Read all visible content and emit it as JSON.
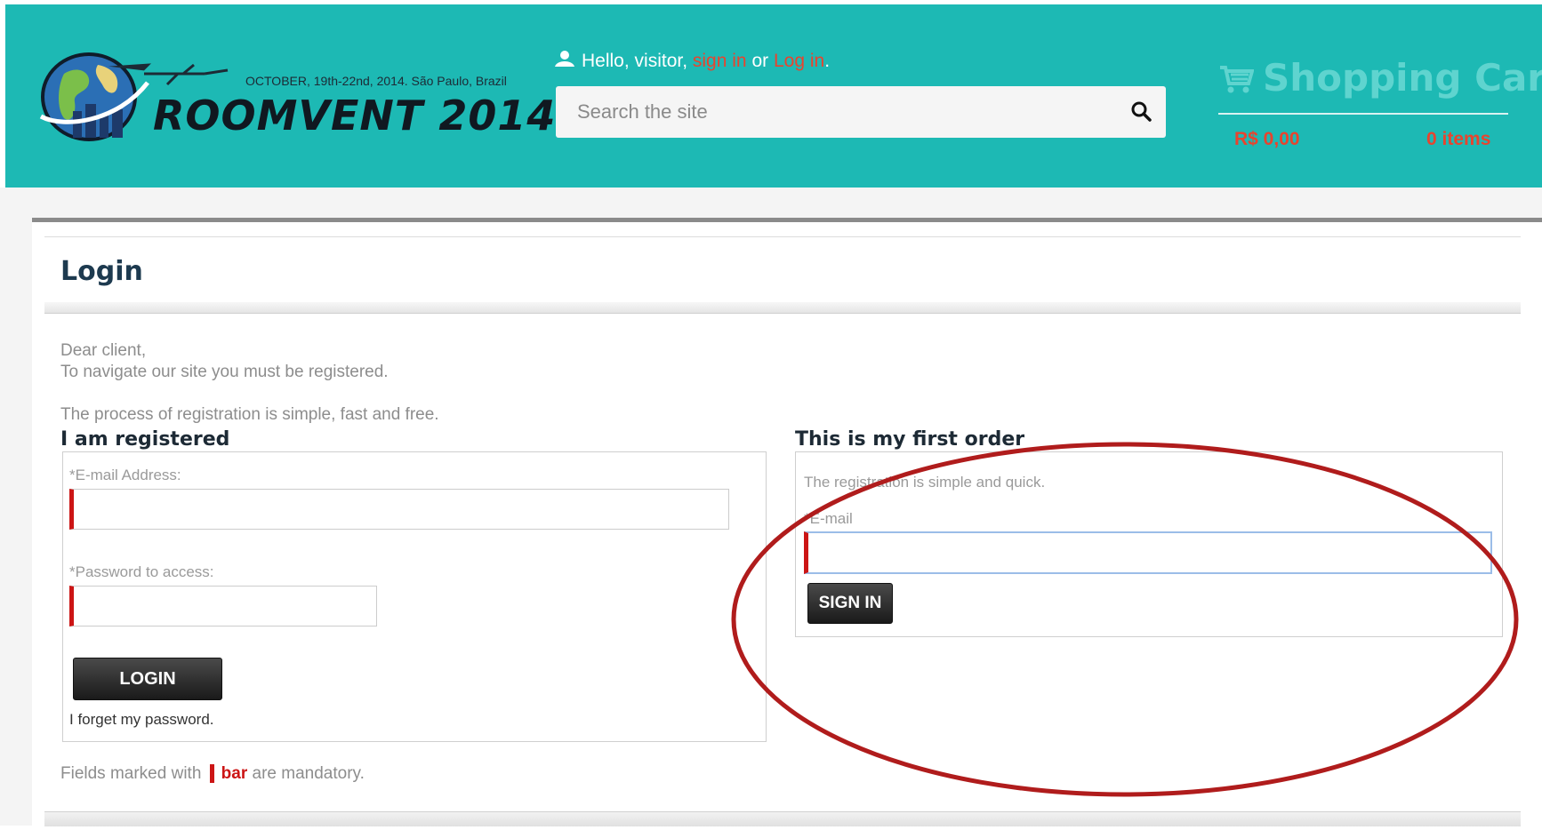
{
  "header": {
    "logo_date": "OCTOBER, 19th-22nd, 2014. São Paulo, Brazil",
    "logo_title": "ROOMVENT 2014",
    "greeting_prefix": "Hello, visitor,",
    "sign_in_link": "sign in",
    "or_text": "or",
    "log_in_link": "Log in",
    "period": ".",
    "search_placeholder": "Search the site",
    "cart_title": "Shopping Cart",
    "cart_price": "R$ 0,00",
    "cart_items": "0 items"
  },
  "page": {
    "title": "Login",
    "intro_line1": "Dear client,",
    "intro_line2": "To navigate our site you must be registered.",
    "intro_line3": "The process of registration is simple, fast and free."
  },
  "registered": {
    "title": "I am registered",
    "email_label": "*E-mail Address:",
    "email_value": "",
    "password_label": "*Password to access:",
    "password_value": "",
    "login_button": "LOGIN",
    "forgot_link": "I forget my password."
  },
  "first_order": {
    "title": "This is my first order",
    "description": "The registration is simple and quick.",
    "email_label": "*E-mail",
    "email_value": "",
    "sign_in_button": "SIGN IN"
  },
  "footer_note": {
    "prefix": "Fields marked with",
    "bar_word": "bar",
    "suffix": "are mandatory."
  },
  "colors": {
    "header_bg": "#1db9b4",
    "link_red": "#e8442e",
    "mandatory_bar": "#cc1515",
    "annotation_circle": "#b01c1c"
  }
}
